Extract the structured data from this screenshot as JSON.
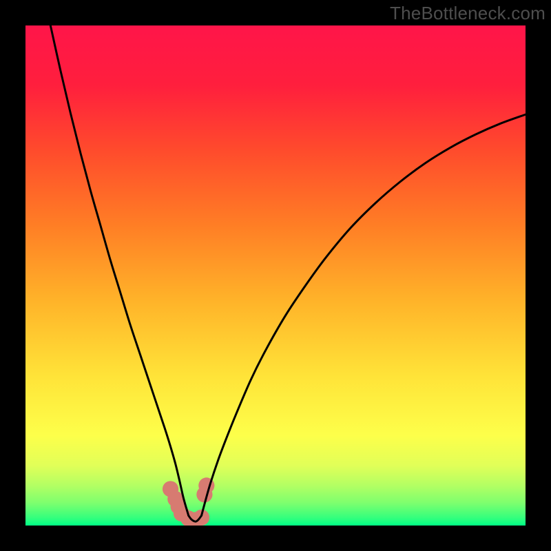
{
  "watermark": "TheBottleneck.com",
  "chart_data": {
    "type": "line",
    "title": "",
    "xlabel": "",
    "ylabel": "",
    "xlim": [
      0,
      100
    ],
    "ylim": [
      0,
      100
    ],
    "gradient_stops": [
      {
        "offset": 0.0,
        "color": "#ff1549"
      },
      {
        "offset": 0.12,
        "color": "#ff1f3d"
      },
      {
        "offset": 0.25,
        "color": "#ff4b2c"
      },
      {
        "offset": 0.4,
        "color": "#ff7e25"
      },
      {
        "offset": 0.55,
        "color": "#ffb329"
      },
      {
        "offset": 0.7,
        "color": "#ffe338"
      },
      {
        "offset": 0.82,
        "color": "#fdff4a"
      },
      {
        "offset": 0.88,
        "color": "#e1ff58"
      },
      {
        "offset": 0.92,
        "color": "#b3ff63"
      },
      {
        "offset": 0.955,
        "color": "#7dff6e"
      },
      {
        "offset": 0.985,
        "color": "#33ff7d"
      },
      {
        "offset": 1.0,
        "color": "#00ff85"
      }
    ],
    "series": [
      {
        "name": "left-branch",
        "x": [
          5.0,
          7.0,
          9.0,
          11.0,
          13.0,
          15.0,
          17.0,
          19.0,
          21.0,
          23.0,
          25.0,
          27.0,
          28.0,
          29.0,
          30.0,
          30.8,
          31.6,
          32.6
        ],
        "y": [
          100.0,
          91.0,
          82.5,
          74.5,
          67.0,
          60.0,
          53.0,
          46.5,
          40.0,
          34.0,
          28.0,
          22.0,
          19.0,
          15.8,
          12.3,
          9.0,
          5.5,
          2.0
        ]
      },
      {
        "name": "right-branch",
        "x": [
          35.2,
          36.0,
          37.0,
          38.5,
          40.0,
          42.0,
          45.0,
          48.0,
          52.0,
          56.0,
          60.0,
          65.0,
          70.0,
          75.0,
          80.0,
          85.0,
          90.0,
          95.0,
          100.0
        ],
        "y": [
          2.0,
          5.0,
          8.5,
          13.0,
          17.0,
          22.0,
          29.0,
          35.0,
          42.0,
          48.0,
          53.5,
          59.5,
          64.5,
          68.8,
          72.5,
          75.6,
          78.2,
          80.4,
          82.2
        ]
      }
    ],
    "bottom_segment": {
      "x": [
        32.6,
        33.2,
        34.0,
        34.6,
        35.2
      ],
      "y": [
        2.0,
        1.2,
        0.8,
        1.2,
        2.0
      ]
    },
    "blob_points": [
      {
        "cx": 29.0,
        "cy": 7.3,
        "r": 1.6
      },
      {
        "cx": 30.0,
        "cy": 5.3,
        "r": 1.6
      },
      {
        "cx": 30.6,
        "cy": 3.8,
        "r": 1.6
      },
      {
        "cx": 31.2,
        "cy": 2.4,
        "r": 1.6
      },
      {
        "cx": 32.6,
        "cy": 1.4,
        "r": 1.6
      },
      {
        "cx": 34.0,
        "cy": 1.1,
        "r": 1.6
      },
      {
        "cx": 35.2,
        "cy": 1.6,
        "r": 1.6
      },
      {
        "cx": 35.8,
        "cy": 6.2,
        "r": 1.6
      },
      {
        "cx": 36.2,
        "cy": 8.0,
        "r": 1.6
      }
    ],
    "blob_color": "#d77b71",
    "curve_color": "#000000",
    "curve_width": 3
  }
}
